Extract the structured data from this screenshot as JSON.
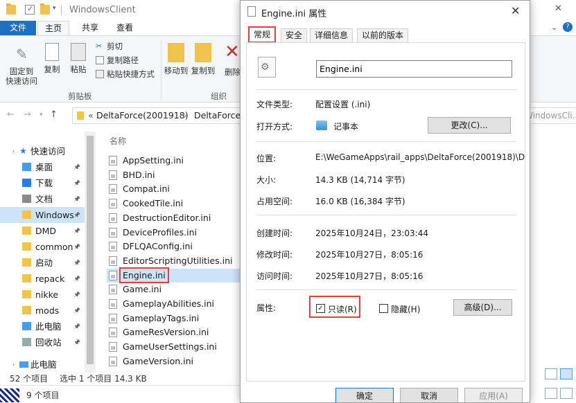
{
  "explorer": {
    "window_title": "WindowsClient",
    "ribbon_tabs": {
      "file": "文件",
      "home": "主页",
      "share": "共享",
      "view": "查看"
    },
    "ribbon": {
      "pin": "固定到\n快速访问",
      "copy": "复制",
      "paste": "粘贴",
      "cut": "剪切",
      "copy_path": "复制路径",
      "paste_shortcut": "粘贴快捷方式",
      "move_to": "移动到",
      "copy_to": "复制到",
      "delete": "删除",
      "clipboard_group": "剪贴板",
      "organize_group": "组织"
    },
    "address": {
      "prefix": "«",
      "crumb1": "DeltaForce(2001918)",
      "crumb2": "DeltaForce",
      "search_partial": "WindowsCli..."
    },
    "nav": {
      "quick_access": "快速访问",
      "items": [
        {
          "label": "桌面",
          "pinned": true
        },
        {
          "label": "下载",
          "pinned": true
        },
        {
          "label": "文档",
          "pinned": true
        },
        {
          "label": "WindowsCl",
          "pinned": true
        },
        {
          "label": "DMD",
          "pinned": true
        },
        {
          "label": "common",
          "pinned": true
        },
        {
          "label": "启动",
          "pinned": true
        },
        {
          "label": "repack",
          "pinned": true
        },
        {
          "label": "nikke",
          "pinned": true
        },
        {
          "label": "mods",
          "pinned": true
        },
        {
          "label": "此电脑",
          "pinned": true
        },
        {
          "label": "回收站",
          "pinned": true
        }
      ],
      "this_pc": "此电脑"
    },
    "file_list": {
      "column_name": "名称",
      "files": [
        "AppSetting.ini",
        "BHD.ini",
        "Compat.ini",
        "CookedTile.ini",
        "DestructionEditor.ini",
        "DeviceProfiles.ini",
        "DFLQAConfig.ini",
        "EditorScriptingUtilities.ini",
        "Engine.ini",
        "Game.ini",
        "GameplayAbilities.ini",
        "GameplayTags.ini",
        "GameResVersion.ini",
        "GameUserSettings.ini",
        "GameVersion.ini"
      ],
      "selected": "Engine.ini"
    },
    "status": {
      "count": "52 个项目",
      "selected": "选中 1 个项目  14.3 KB"
    },
    "taskbar_count": "9 个项目"
  },
  "dialog": {
    "title": "Engine.ini 属性",
    "tabs": [
      "常规",
      "安全",
      "详细信息",
      "以前的版本"
    ],
    "file_name": "Engine.ini",
    "labels": {
      "type": "文件类型:",
      "opens_with": "打开方式:",
      "location": "位置:",
      "size": "大小:",
      "size_on_disk": "占用空间:",
      "created": "创建时间:",
      "modified": "修改时间:",
      "accessed": "访问时间:",
      "attributes": "属性:"
    },
    "values": {
      "type": "配置设置 (.ini)",
      "opens_with": "记事本",
      "location": "E:\\WeGameApps\\rail_apps\\DeltaForce(2001918)\\D",
      "size": "14.3 KB (14,714 字节)",
      "size_on_disk": "16.0 KB (16,384 字节)",
      "created": "2025年10月24日，23:03:44",
      "modified": "2025年10月27日，8:05:16",
      "accessed": "2025年10月27日，8:05:16"
    },
    "buttons": {
      "change": "更改(C)...",
      "advanced": "高级(D)...",
      "ok": "确定",
      "cancel": "取消",
      "apply": "应用(A)"
    },
    "attributes": {
      "readonly": "只读(R)",
      "readonly_checked": true,
      "hidden": "隐藏(H)",
      "hidden_checked": false
    }
  }
}
